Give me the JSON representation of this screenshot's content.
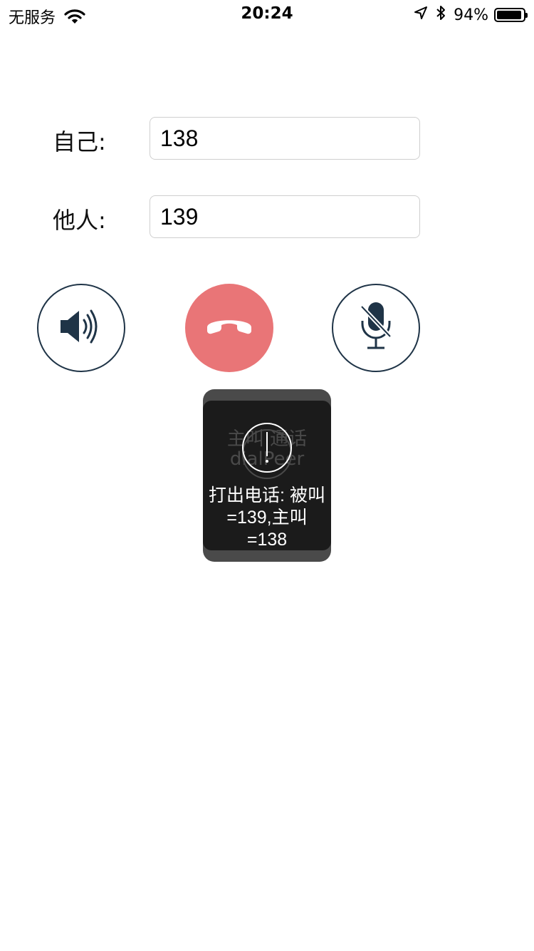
{
  "status_bar": {
    "carrier": "无服务",
    "time": "20:24",
    "battery_percent": "94%",
    "battery_level": 0.94,
    "icons": [
      "wifi-icon",
      "location-arrow-icon",
      "bluetooth-icon",
      "battery-icon"
    ]
  },
  "form": {
    "self_label": "自己:",
    "self_value": "138",
    "other_label": "他人:",
    "other_value": "139"
  },
  "controls": {
    "speaker_icon": "speaker-icon",
    "hangup_icon": "phone-hangup-icon",
    "mute_icon": "microphone-muted-icon",
    "hangup_color": "#e97577",
    "outline_color": "#1f3447"
  },
  "toast": {
    "icon": "exclamation-circle-icon",
    "message_lines": [
      "打出电话: 被叫",
      "=139,主叫",
      "=138"
    ],
    "background_text": "主叫  通话 dialPeer"
  }
}
